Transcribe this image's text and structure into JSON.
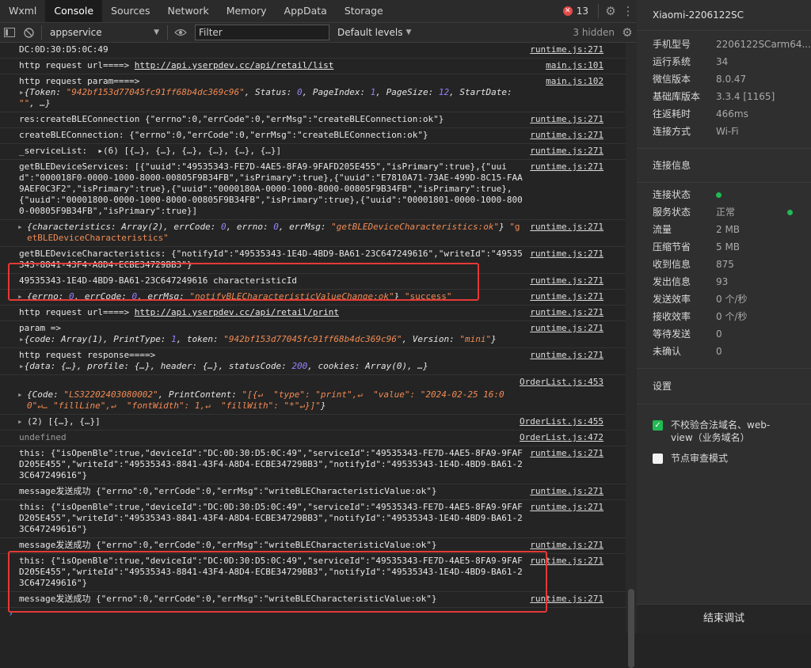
{
  "tabs": [
    "Wxml",
    "Console",
    "Sources",
    "Network",
    "Memory",
    "AppData",
    "Storage"
  ],
  "active_tab": "Console",
  "error_count": "13",
  "toolbar": {
    "context": "appservice",
    "filter_placeholder": "Filter",
    "levels": "Default levels",
    "hidden": "3 hidden"
  },
  "logs": {
    "r0": {
      "src": "runtime.js:271"
    },
    "r1": {
      "prefix": "http request url====> ",
      "url": "http://api.yserpdev.cc/api/retail/list",
      "src": "main.js:101"
    },
    "r2": {
      "src": "main.js:102"
    },
    "r3": {
      "text": "res:createBLEConnection {\"errno\":0,\"errCode\":0,\"errMsg\":\"createBLEConnection:ok\"}",
      "src": "runtime.js:271"
    },
    "r4": {
      "text": "createBLEConnection: {\"errno\":0,\"errCode\":0,\"errMsg\":\"createBLEConnection:ok\"}",
      "src": "runtime.js:271"
    },
    "r5": {
      "text": "_serviceList:  ▸(6) [{…}, {…}, {…}, {…}, {…}, {…}]",
      "src": "runtime.js:271"
    },
    "r6": {
      "text": "getBLEDeviceServices: [{\"uuid\":\"49535343-FE7D-4AE5-8FA9-9FAFD205E455\",\"isPrimary\":true},{\"uuid\":\"000018F0-0000-1000-8000-00805F9B34FB\",\"isPrimary\":true},{\"uuid\":\"E7810A71-73AE-499D-8C15-FAA9AEF0C3F2\",\"isPrimary\":true},{\"uuid\":\"0000180A-0000-1000-8000-00805F9B34FB\",\"isPrimary\":true},{\"uuid\":\"00001800-0000-1000-8000-00805F9B34FB\",\"isPrimary\":true},{\"uuid\":\"00001801-0000-1000-8000-00805F9B34FB\",\"isPrimary\":true}]",
      "src": "runtime.js:271"
    },
    "r7": {
      "src": "runtime.js:271"
    },
    "r8": {
      "text": "getBLEDeviceCharacteristics: {\"notifyId\":\"49535343-1E4D-4BD9-BA61-23C647249616\",\"writeId\":\"49535343-8841-43F4-A8D4-ECBE34729BB3\"}",
      "src": "runtime.js:271"
    },
    "r9": {
      "text": "49535343-1E4D-4BD9-BA61-23C647249616 characteristicId",
      "src": "runtime.js:271"
    },
    "r10": {
      "src": "runtime.js:271"
    },
    "r11": {
      "prefix": "http request url====> ",
      "url": "http://api.yserpdev.cc/api/retail/print",
      "src": "runtime.js:271"
    },
    "r12": {
      "src": "runtime.js:271"
    },
    "r13": {
      "src": "runtime.js:271"
    },
    "r14": {
      "src": "OrderList.js:453"
    },
    "r15": {
      "text": "(2) [{…}, {…}]",
      "src": "OrderList.js:455"
    },
    "r16": {
      "text": "undefined",
      "src": "OrderList.js:472"
    },
    "r17": {
      "text": "this: {\"isOpenBle\":true,\"deviceId\":\"DC:0D:30:D5:0C:49\",\"serviceId\":\"49535343-FE7D-4AE5-8FA9-9FAFD205E455\",\"writeId\":\"49535343-8841-43F4-A8D4-ECBE34729BB3\",\"notifyId\":\"49535343-1E4D-4BD9-BA61-23C647249616\"}",
      "src": "runtime.js:271"
    },
    "r18": {
      "text": "message发送成功 {\"errno\":0,\"errCode\":0,\"errMsg\":\"writeBLECharacteristicValue:ok\"}",
      "src": "runtime.js:271"
    },
    "r19": {
      "text": "this: {\"isOpenBle\":true,\"deviceId\":\"DC:0D:30:D5:0C:49\",\"serviceId\":\"49535343-FE7D-4AE5-8FA9-9FAFD205E455\",\"writeId\":\"49535343-8841-43F4-A8D4-ECBE34729BB3\",\"notifyId\":\"49535343-1E4D-4BD9-BA61-23C647249616\"}",
      "src": "runtime.js:271"
    },
    "r20": {
      "text": "message发送成功 {\"errno\":0,\"errCode\":0,\"errMsg\":\"writeBLECharacteristicValue:ok\"}",
      "src": "runtime.js:271"
    },
    "r21": {
      "text": "this: {\"isOpenBle\":true,\"deviceId\":\"DC:0D:30:D5:0C:49\",\"serviceId\":\"49535343-FE7D-4AE5-8FA9-9FAFD205E455\",\"writeId\":\"49535343-8841-43F4-A8D4-ECBE34729BB3\",\"notifyId\":\"49535343-1E4D-4BD9-BA61-23C647249616\"}",
      "src": "runtime.js:271"
    },
    "r22": {
      "text": "message发送成功 {\"errno\":0,\"errCode\":0,\"errMsg\":\"writeBLECharacteristicValue:ok\"}",
      "src": "runtime.js:271"
    }
  },
  "device": {
    "name": "Xiaomi-2206122SC",
    "info": [
      {
        "k": "手机型号",
        "v": "2206122SCarm64..."
      },
      {
        "k": "运行系统",
        "v": "34"
      },
      {
        "k": "微信版本",
        "v": "8.0.47"
      },
      {
        "k": "基础库版本",
        "v": "3.3.4 [1165]"
      },
      {
        "k": "往返耗时",
        "v": "466ms"
      },
      {
        "k": "连接方式",
        "v": "Wi-Fi"
      }
    ],
    "conn_title": "连接信息",
    "conn": [
      {
        "k": "连接状态",
        "v": ""
      },
      {
        "k": "服务状态",
        "v": "正常"
      },
      {
        "k": "流量",
        "v": "2 MB"
      },
      {
        "k": "压缩节省",
        "v": "5 MB"
      },
      {
        "k": "收到信息",
        "v": "875"
      },
      {
        "k": "发出信息",
        "v": "93"
      },
      {
        "k": "发送效率",
        "v": "0 个/秒"
      },
      {
        "k": "接收效率",
        "v": "0 个/秒"
      },
      {
        "k": "等待发送",
        "v": "0"
      },
      {
        "k": "未确认",
        "v": "0"
      }
    ],
    "settings_title": "设置",
    "opt1": "不校验合法域名、web-view（业务域名）",
    "opt2": "节点审查模式",
    "end_button": "结束调试"
  }
}
